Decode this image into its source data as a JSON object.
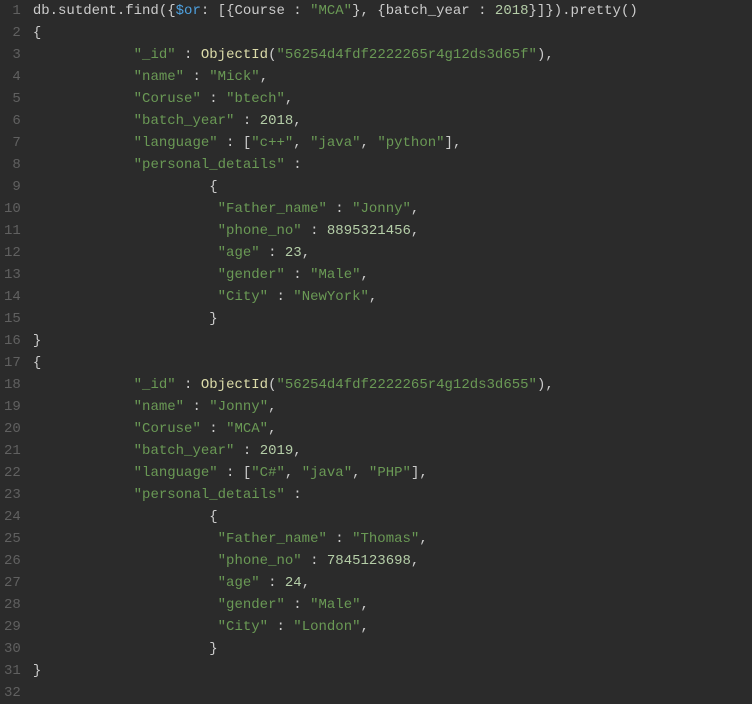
{
  "lines": [
    {
      "n": "1",
      "tokens": [
        {
          "c": "t-plain",
          "t": "db.sutdent.find({"
        },
        {
          "c": "t-key",
          "t": "$or"
        },
        {
          "c": "t-plain",
          "t": ": [{Course : "
        },
        {
          "c": "t-str",
          "t": "\"MCA\""
        },
        {
          "c": "t-plain",
          "t": "}, {batch_year : "
        },
        {
          "c": "t-num",
          "t": "2018"
        },
        {
          "c": "t-plain",
          "t": "}]}).pretty()"
        }
      ]
    },
    {
      "n": "2",
      "tokens": [
        {
          "c": "t-plain",
          "t": "{"
        }
      ]
    },
    {
      "n": "3",
      "tokens": [
        {
          "c": "t-plain",
          "t": "            "
        },
        {
          "c": "t-str",
          "t": "\"_id\""
        },
        {
          "c": "t-plain",
          "t": " : "
        },
        {
          "c": "t-objid",
          "t": "ObjectId"
        },
        {
          "c": "t-plain",
          "t": "("
        },
        {
          "c": "t-str",
          "t": "\"56254d4fdf2222265r4g12ds3d65f\""
        },
        {
          "c": "t-plain",
          "t": "),"
        }
      ]
    },
    {
      "n": "4",
      "tokens": [
        {
          "c": "t-plain",
          "t": "            "
        },
        {
          "c": "t-str",
          "t": "\"name\""
        },
        {
          "c": "t-plain",
          "t": " : "
        },
        {
          "c": "t-str",
          "t": "\"Mick\""
        },
        {
          "c": "t-plain",
          "t": ","
        }
      ]
    },
    {
      "n": "5",
      "tokens": [
        {
          "c": "t-plain",
          "t": "            "
        },
        {
          "c": "t-str",
          "t": "\"Coruse\""
        },
        {
          "c": "t-plain",
          "t": " : "
        },
        {
          "c": "t-str",
          "t": "\"btech\""
        },
        {
          "c": "t-plain",
          "t": ","
        }
      ]
    },
    {
      "n": "6",
      "tokens": [
        {
          "c": "t-plain",
          "t": "            "
        },
        {
          "c": "t-str",
          "t": "\"batch_year\""
        },
        {
          "c": "t-plain",
          "t": " : "
        },
        {
          "c": "t-num",
          "t": "2018"
        },
        {
          "c": "t-plain",
          "t": ","
        }
      ]
    },
    {
      "n": "7",
      "tokens": [
        {
          "c": "t-plain",
          "t": "            "
        },
        {
          "c": "t-str",
          "t": "\"language\""
        },
        {
          "c": "t-plain",
          "t": " : ["
        },
        {
          "c": "t-str",
          "t": "\"c++\""
        },
        {
          "c": "t-plain",
          "t": ", "
        },
        {
          "c": "t-str",
          "t": "\"java\""
        },
        {
          "c": "t-plain",
          "t": ", "
        },
        {
          "c": "t-str",
          "t": "\"python\""
        },
        {
          "c": "t-plain",
          "t": "],"
        }
      ]
    },
    {
      "n": "8",
      "tokens": [
        {
          "c": "t-plain",
          "t": "            "
        },
        {
          "c": "t-str",
          "t": "\"personal_details\""
        },
        {
          "c": "t-plain",
          "t": " :"
        }
      ]
    },
    {
      "n": "9",
      "tokens": [
        {
          "c": "t-plain",
          "t": "                     {"
        }
      ]
    },
    {
      "n": "10",
      "tokens": [
        {
          "c": "t-plain",
          "t": "                      "
        },
        {
          "c": "t-str",
          "t": "\"Father_name\""
        },
        {
          "c": "t-plain",
          "t": " : "
        },
        {
          "c": "t-str",
          "t": "\"Jonny\""
        },
        {
          "c": "t-plain",
          "t": ","
        }
      ]
    },
    {
      "n": "11",
      "tokens": [
        {
          "c": "t-plain",
          "t": "                      "
        },
        {
          "c": "t-str",
          "t": "\"phone_no\""
        },
        {
          "c": "t-plain",
          "t": " : "
        },
        {
          "c": "t-num",
          "t": "8895321456"
        },
        {
          "c": "t-plain",
          "t": ","
        }
      ]
    },
    {
      "n": "12",
      "tokens": [
        {
          "c": "t-plain",
          "t": "                      "
        },
        {
          "c": "t-str",
          "t": "\"age\""
        },
        {
          "c": "t-plain",
          "t": " : "
        },
        {
          "c": "t-num",
          "t": "23"
        },
        {
          "c": "t-plain",
          "t": ","
        }
      ]
    },
    {
      "n": "13",
      "tokens": [
        {
          "c": "t-plain",
          "t": "                      "
        },
        {
          "c": "t-str",
          "t": "\"gender\""
        },
        {
          "c": "t-plain",
          "t": " : "
        },
        {
          "c": "t-str",
          "t": "\"Male\""
        },
        {
          "c": "t-plain",
          "t": ","
        }
      ]
    },
    {
      "n": "14",
      "tokens": [
        {
          "c": "t-plain",
          "t": "                      "
        },
        {
          "c": "t-str",
          "t": "\"City\""
        },
        {
          "c": "t-plain",
          "t": " : "
        },
        {
          "c": "t-str",
          "t": "\"NewYork\""
        },
        {
          "c": "t-plain",
          "t": ","
        }
      ]
    },
    {
      "n": "15",
      "tokens": [
        {
          "c": "t-plain",
          "t": "                     }"
        }
      ]
    },
    {
      "n": "16",
      "tokens": [
        {
          "c": "t-plain",
          "t": "}"
        }
      ]
    },
    {
      "n": "17",
      "tokens": [
        {
          "c": "t-plain",
          "t": "{"
        }
      ]
    },
    {
      "n": "18",
      "tokens": [
        {
          "c": "t-plain",
          "t": "            "
        },
        {
          "c": "t-str",
          "t": "\"_id\""
        },
        {
          "c": "t-plain",
          "t": " : "
        },
        {
          "c": "t-objid",
          "t": "ObjectId"
        },
        {
          "c": "t-plain",
          "t": "("
        },
        {
          "c": "t-str",
          "t": "\"56254d4fdf2222265r4g12ds3d655\""
        },
        {
          "c": "t-plain",
          "t": "),"
        }
      ]
    },
    {
      "n": "19",
      "tokens": [
        {
          "c": "t-plain",
          "t": "            "
        },
        {
          "c": "t-str",
          "t": "\"name\""
        },
        {
          "c": "t-plain",
          "t": " : "
        },
        {
          "c": "t-str",
          "t": "\"Jonny\""
        },
        {
          "c": "t-plain",
          "t": ","
        }
      ]
    },
    {
      "n": "20",
      "tokens": [
        {
          "c": "t-plain",
          "t": "            "
        },
        {
          "c": "t-str",
          "t": "\"Coruse\""
        },
        {
          "c": "t-plain",
          "t": " : "
        },
        {
          "c": "t-str",
          "t": "\"MCA\""
        },
        {
          "c": "t-plain",
          "t": ","
        }
      ]
    },
    {
      "n": "21",
      "tokens": [
        {
          "c": "t-plain",
          "t": "            "
        },
        {
          "c": "t-str",
          "t": "\"batch_year\""
        },
        {
          "c": "t-plain",
          "t": " : "
        },
        {
          "c": "t-num",
          "t": "2019"
        },
        {
          "c": "t-plain",
          "t": ","
        }
      ]
    },
    {
      "n": "22",
      "tokens": [
        {
          "c": "t-plain",
          "t": "            "
        },
        {
          "c": "t-str",
          "t": "\"language\""
        },
        {
          "c": "t-plain",
          "t": " : ["
        },
        {
          "c": "t-str",
          "t": "\"C#\""
        },
        {
          "c": "t-plain",
          "t": ", "
        },
        {
          "c": "t-str",
          "t": "\"java\""
        },
        {
          "c": "t-plain",
          "t": ", "
        },
        {
          "c": "t-str",
          "t": "\"PHP\""
        },
        {
          "c": "t-plain",
          "t": "],"
        }
      ]
    },
    {
      "n": "23",
      "tokens": [
        {
          "c": "t-plain",
          "t": "            "
        },
        {
          "c": "t-str",
          "t": "\"personal_details\""
        },
        {
          "c": "t-plain",
          "t": " :"
        }
      ]
    },
    {
      "n": "24",
      "tokens": [
        {
          "c": "t-plain",
          "t": "                     {"
        }
      ]
    },
    {
      "n": "25",
      "tokens": [
        {
          "c": "t-plain",
          "t": "                      "
        },
        {
          "c": "t-str",
          "t": "\"Father_name\""
        },
        {
          "c": "t-plain",
          "t": " : "
        },
        {
          "c": "t-str",
          "t": "\"Thomas\""
        },
        {
          "c": "t-plain",
          "t": ","
        }
      ]
    },
    {
      "n": "26",
      "tokens": [
        {
          "c": "t-plain",
          "t": "                      "
        },
        {
          "c": "t-str",
          "t": "\"phone_no\""
        },
        {
          "c": "t-plain",
          "t": " : "
        },
        {
          "c": "t-num",
          "t": "7845123698"
        },
        {
          "c": "t-plain",
          "t": ","
        }
      ]
    },
    {
      "n": "27",
      "tokens": [
        {
          "c": "t-plain",
          "t": "                      "
        },
        {
          "c": "t-str",
          "t": "\"age\""
        },
        {
          "c": "t-plain",
          "t": " : "
        },
        {
          "c": "t-num",
          "t": "24"
        },
        {
          "c": "t-plain",
          "t": ","
        }
      ]
    },
    {
      "n": "28",
      "tokens": [
        {
          "c": "t-plain",
          "t": "                      "
        },
        {
          "c": "t-str",
          "t": "\"gender\""
        },
        {
          "c": "t-plain",
          "t": " : "
        },
        {
          "c": "t-str",
          "t": "\"Male\""
        },
        {
          "c": "t-plain",
          "t": ","
        }
      ]
    },
    {
      "n": "29",
      "tokens": [
        {
          "c": "t-plain",
          "t": "                      "
        },
        {
          "c": "t-str",
          "t": "\"City\""
        },
        {
          "c": "t-plain",
          "t": " : "
        },
        {
          "c": "t-str",
          "t": "\"London\""
        },
        {
          "c": "t-plain",
          "t": ","
        }
      ]
    },
    {
      "n": "30",
      "tokens": [
        {
          "c": "t-plain",
          "t": "                     }"
        }
      ]
    },
    {
      "n": "31",
      "tokens": [
        {
          "c": "t-plain",
          "t": "}"
        }
      ]
    },
    {
      "n": "32",
      "tokens": [
        {
          "c": "t-plain",
          "t": ""
        }
      ]
    }
  ]
}
